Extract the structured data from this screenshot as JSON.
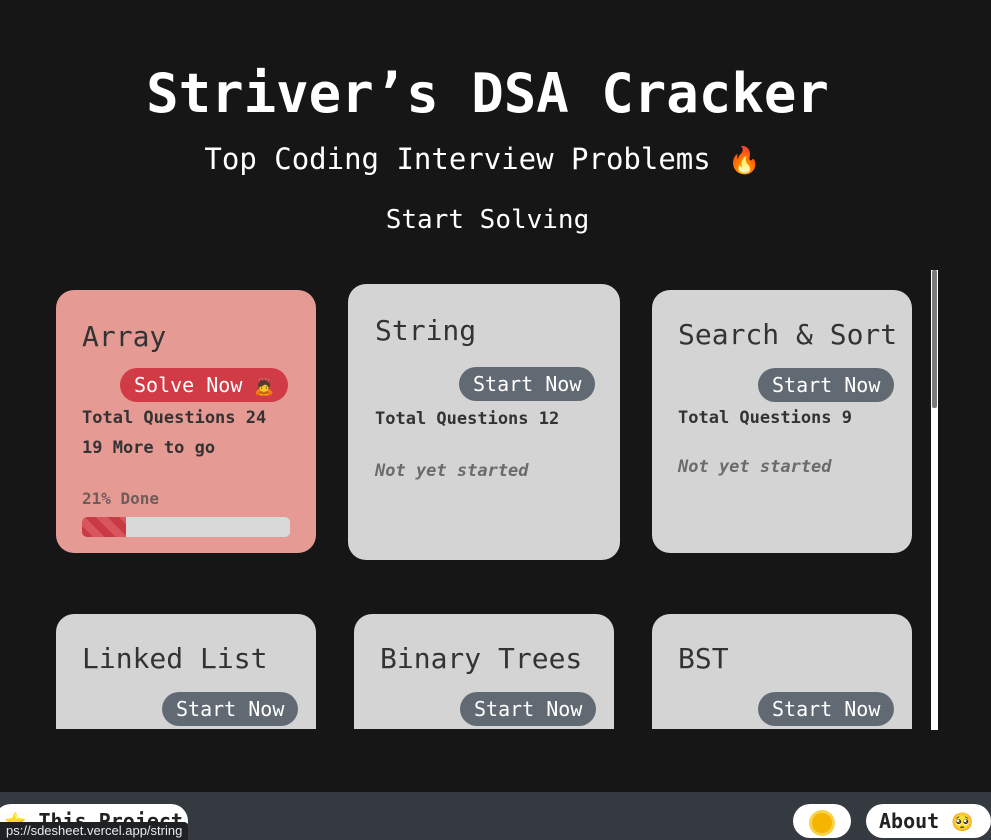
{
  "header": {
    "title": "Striver’s DSA Cracker",
    "subtitle": "Top Coding Interview Problems",
    "subtitle_icon": "🔥",
    "cta": "Start Solving"
  },
  "cards": [
    {
      "title": "Array",
      "button": "Solve Now",
      "button_icon": "🙇",
      "total": "Total Questions 24",
      "remaining": "19 More to go",
      "progress_label": "21% Done",
      "progress": 0.21
    },
    {
      "title": "String",
      "button": "Start Now",
      "total": "Total Questions 12",
      "status": "Not yet started"
    },
    {
      "title": "Search & Sort",
      "button": "Start Now",
      "total": "Total Questions 9",
      "status": "Not yet started"
    },
    {
      "title": "Linked List",
      "button": "Start Now"
    },
    {
      "title": "Binary Trees",
      "button": "Start Now"
    },
    {
      "title": "BST",
      "button": "Start Now"
    }
  ],
  "footer": {
    "project_label": "This Project",
    "project_icon": "⭐",
    "about_label": "About",
    "about_icon": "🥺",
    "theme_icon": "sun-icon"
  },
  "status_url": "ps://sdesheet.vercel.app/string",
  "colors": {
    "accent": "#d13b45",
    "card": "#d4d4d4",
    "active_card": "#e69a94",
    "button": "#616a73"
  }
}
